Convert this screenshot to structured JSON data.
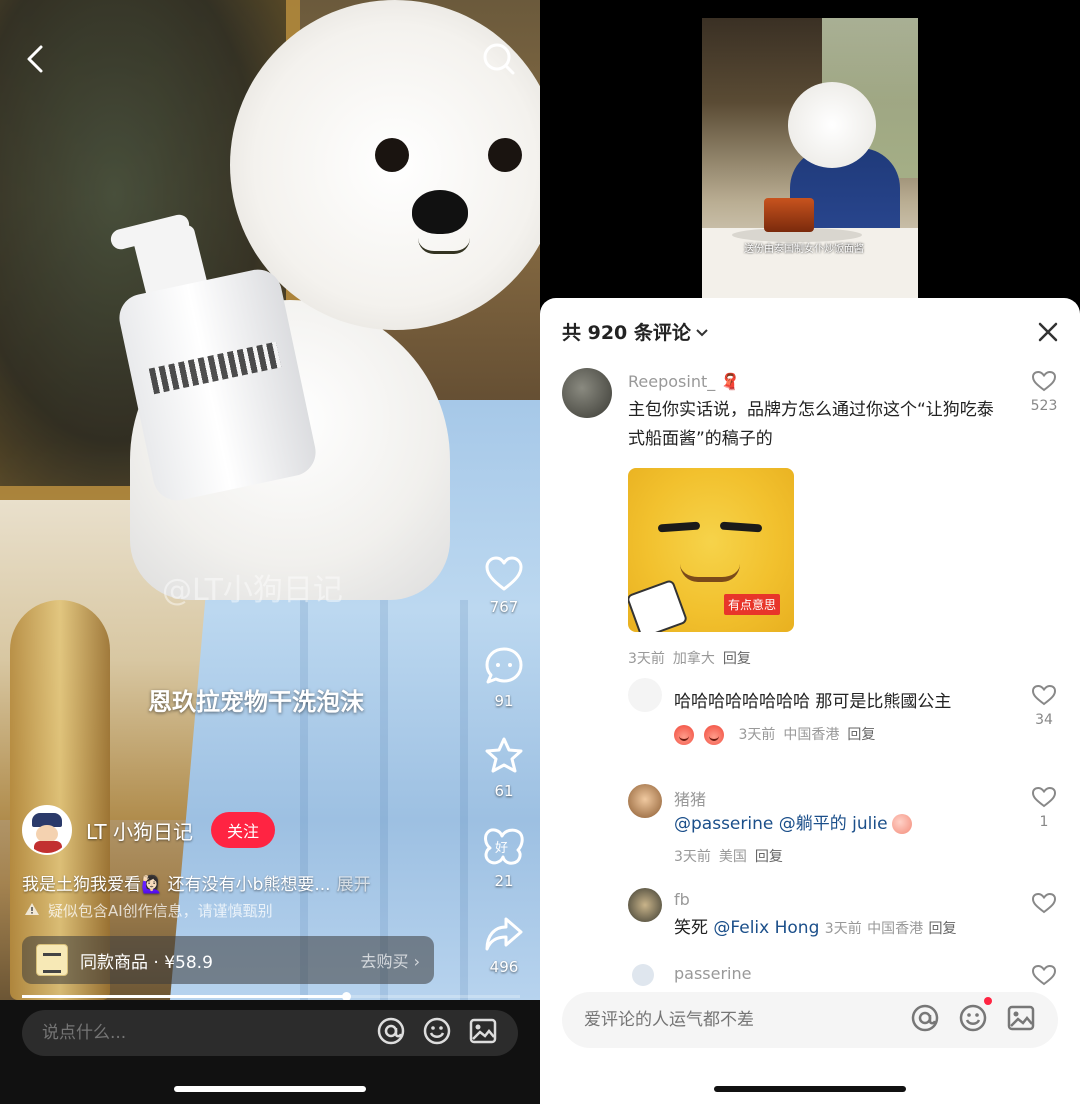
{
  "left": {
    "watermark": "@LT小狗日记",
    "product_title": "恩玖拉宠物干洗泡沫",
    "actions": {
      "likes": "767",
      "comments": "91",
      "favorites": "61",
      "shares_label": "21",
      "forwards": "496"
    },
    "author": {
      "name": "LT 小狗日记",
      "follow_label": "关注"
    },
    "description": "我是土狗我爱看🙋🏻‍♀️ 还有没有小b熊想要...",
    "description_more": "展开",
    "ai_notice": "疑似包含AI创作信息，请谨慎甄别",
    "shop": {
      "label": "同款商品 · ¥58.9",
      "action": "去购买 ›"
    },
    "progress": 0.65,
    "input_placeholder": "说点什么..."
  },
  "right": {
    "video_caption": "送份由泰国制女仆炒饭面酱",
    "sheet_title": "共 920 条评论",
    "comments": [
      {
        "user": "Reeposint_ 🧣",
        "text": "主包你实话说，品牌方怎么通过你这个“让狗吃泰式船面酱”的稿子的",
        "meme_tag": "有点意思",
        "time": "3天前",
        "location": "加拿大",
        "reply": "回复",
        "likes": "523"
      },
      {
        "user": "",
        "text": "哈哈哈哈哈哈哈哈 那可是比熊國公主",
        "time": "3天前",
        "location": "中国香港",
        "reply": "回复",
        "likes": "34"
      },
      {
        "user": "猪猪",
        "mention1": "@passerine",
        "mention2": "@躺平的 julie",
        "time": "3天前",
        "location": "美国",
        "reply": "回复",
        "likes": "1"
      },
      {
        "user": "fb",
        "text_prefix": "笑死",
        "mention": "@Felix Hong",
        "time": "3天前",
        "location": "中国香港",
        "reply": "回复"
      },
      {
        "user": "passerine"
      }
    ],
    "input_placeholder": "爱评论的人运气都不差"
  },
  "colors": {
    "accent": "#ff2442",
    "mention": "#1b4f8a"
  }
}
